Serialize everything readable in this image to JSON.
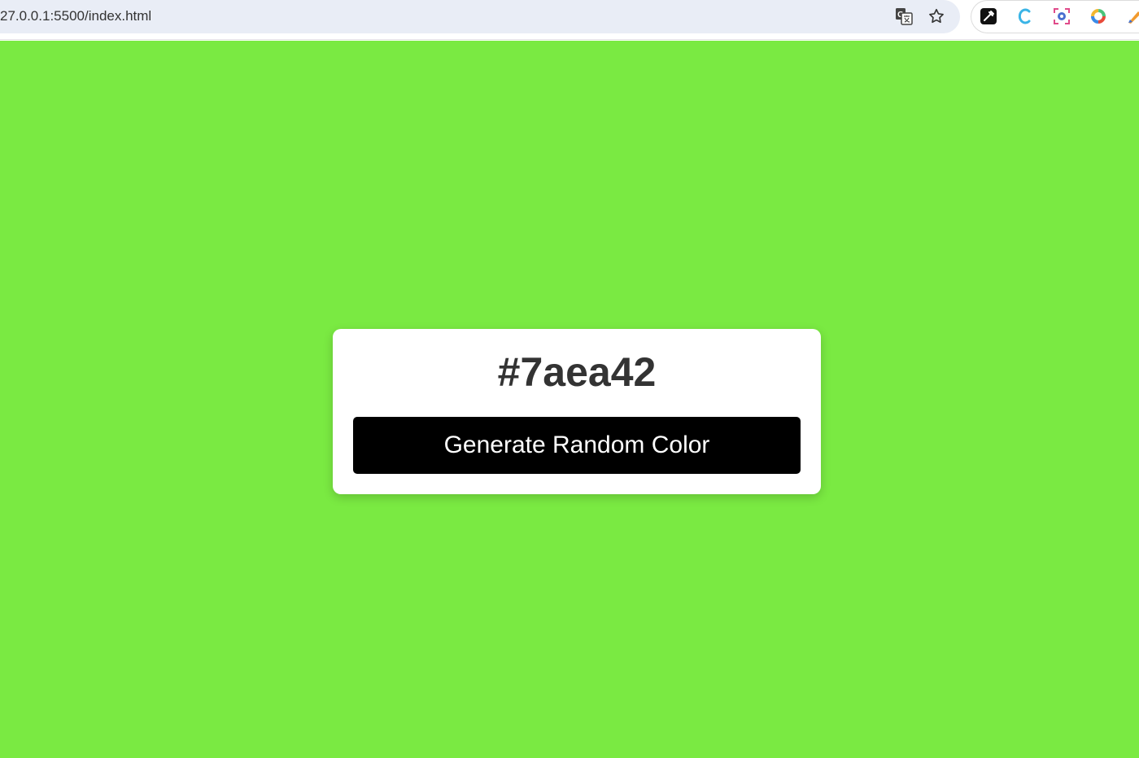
{
  "browser": {
    "url": "27.0.0.1:5500/index.html",
    "icons": {
      "translate": "translate-icon",
      "bookmark": "star-icon",
      "extensions": [
        "eyedropper-extension-icon",
        "c-extension-icon",
        "screenshot-extension-icon",
        "color-ring-extension-icon",
        "pen-extension-icon"
      ]
    }
  },
  "page": {
    "background_color": "#7aea42",
    "color_code": "#7aea42",
    "button_label": "Generate Random Color"
  }
}
